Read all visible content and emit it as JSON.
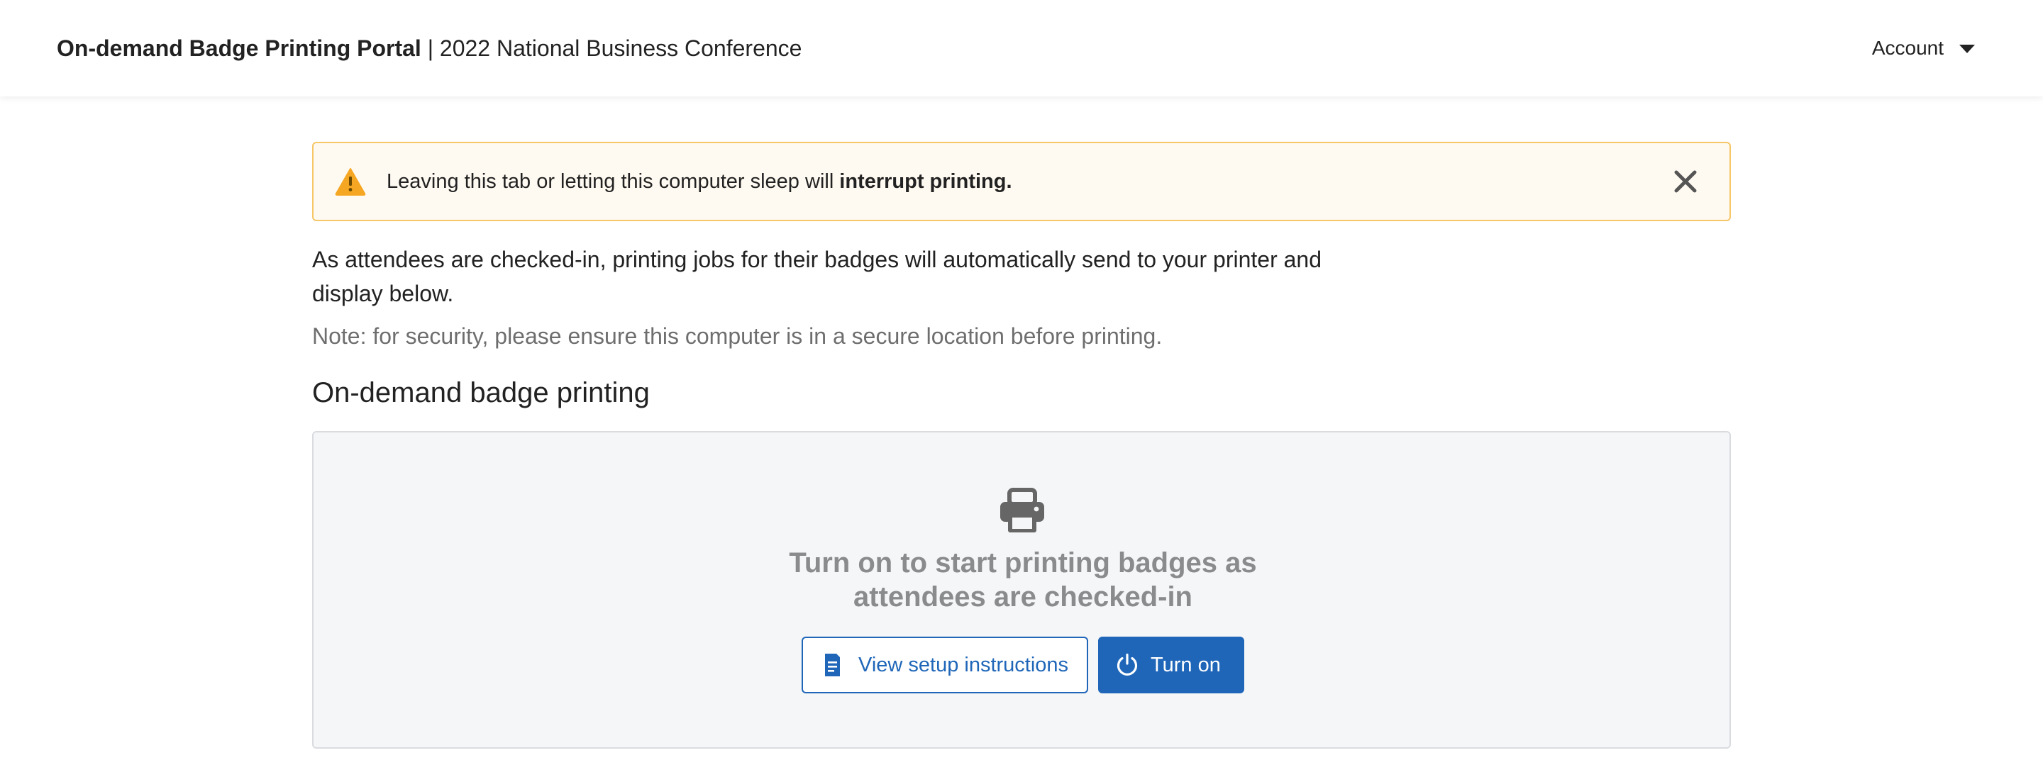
{
  "header": {
    "portal_name": "On-demand Badge Printing Portal",
    "separator": " | ",
    "event_name": "2022 National Business Conference",
    "account_label": "Account"
  },
  "alert": {
    "text": "Leaving this tab or letting this computer sleep will",
    "emphasis": "interrupt printing.",
    "icon": "warning-triangle-icon",
    "close_icon": "close-icon",
    "icon_color": "#f5a623",
    "background_color": "#fffaf1",
    "border_color": "#f6c667"
  },
  "intro": {
    "text": "As attendees are checked-in, printing jobs for their badges will automatically send to your printer and display below.",
    "note": "Note: for security, please ensure this computer is in a secure location before printing."
  },
  "section": {
    "title": "On-demand badge printing"
  },
  "panel": {
    "icon": "printer-icon",
    "message": "Turn on to start printing badges as\nattendees are checked-in",
    "setup_button_label": "View setup instructions",
    "setup_button_icon": "document-icon",
    "turn_on_button_label": "Turn on",
    "turn_on_button_icon": "power-icon"
  },
  "colors": {
    "primary": "#1f66b9",
    "muted_text": "#6e6e6e",
    "panel_background": "#f5f6f8"
  }
}
